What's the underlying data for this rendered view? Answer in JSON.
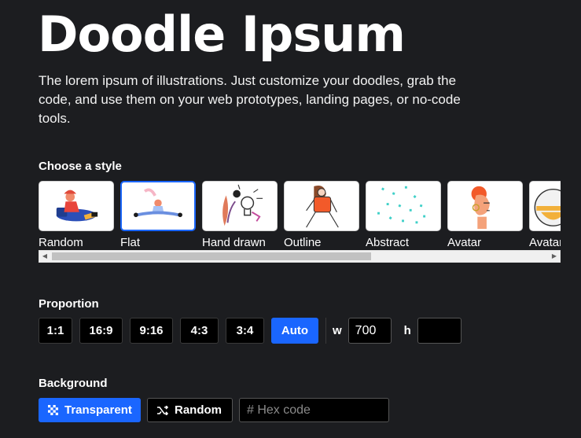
{
  "app": {
    "title": "Doodle Ipsum",
    "description": "The lorem ipsum of illustrations. Just customize your doodles, grab the code, and use them on your web prototypes, landing pages, or no-code tools."
  },
  "style_section": {
    "label": "Choose a style",
    "selected": "Flat",
    "styles": [
      {
        "label": "Random",
        "icon": "random-illustration"
      },
      {
        "label": "Flat",
        "icon": "flat-illustration"
      },
      {
        "label": "Hand drawn",
        "icon": "hand-drawn-illustration"
      },
      {
        "label": "Outline",
        "icon": "outline-illustration"
      },
      {
        "label": "Abstract",
        "icon": "abstract-illustration"
      },
      {
        "label": "Avatar",
        "icon": "avatar-illustration"
      },
      {
        "label": "Avatar",
        "icon": "avatar-illustration"
      }
    ],
    "scrollbar_position": 0.0
  },
  "proportion_section": {
    "label": "Proportion",
    "options": [
      "1:1",
      "16:9",
      "9:16",
      "4:3",
      "3:4",
      "Auto"
    ],
    "selected": "Auto",
    "width_label": "w",
    "width_value": "700",
    "height_label": "h",
    "height_value": ""
  },
  "background_section": {
    "label": "Background",
    "transparent_label": "Transparent",
    "random_label": "Random",
    "hex_placeholder": "# Hex code"
  },
  "colors": {
    "background": "#1c1d20",
    "accent": "#1a66ff",
    "button_dark": "#000000"
  }
}
